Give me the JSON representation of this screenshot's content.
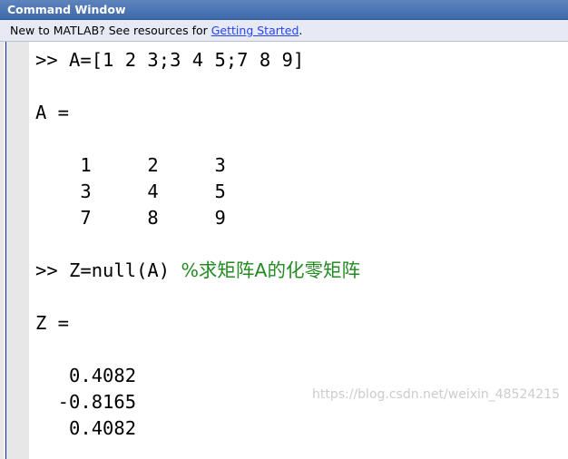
{
  "window": {
    "title": "Command Window"
  },
  "infobar": {
    "text": "New to MATLAB? See resources for ",
    "link": "Getting Started",
    "suffix": "."
  },
  "console": {
    "command1": ">> A=[1 2 3;3 4 5;7 8 9]",
    "output_a_label": "A =",
    "matrix_rows": [
      "    1     2     3",
      "    3     4     5",
      "    7     8     9"
    ],
    "command2": ">> Z=null(A) ",
    "command2_comment": "%求矩阵A的化零矩阵",
    "output_z_label": "Z =",
    "z_rows": [
      "   0.4082",
      "  -0.8165",
      "   0.4082"
    ]
  },
  "watermark": {
    "text": "https://blog.csdn.net/weixin_48524215"
  },
  "colors": {
    "title_bar": "#4a74b4",
    "info_link": "#2442ff",
    "comment": "#228b22"
  },
  "icons": []
}
